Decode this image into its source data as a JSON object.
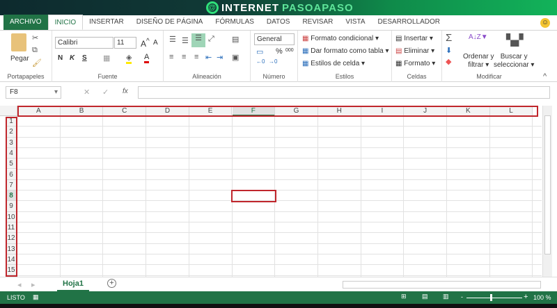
{
  "logo": {
    "text_a": "INTERNET",
    "text_b": "PASOAPASO"
  },
  "tabs": [
    "ARCHIVO",
    "INICIO",
    "INSERTAR",
    "DISEÑO DE PÁGINA",
    "FÓRMULAS",
    "DATOS",
    "REVISAR",
    "VISTA",
    "DESARROLLADOR"
  ],
  "active_tab": "INICIO",
  "ribbon": {
    "portapapeles": {
      "label": "Portapapeles",
      "paste": "Pegar"
    },
    "fuente": {
      "label": "Fuente",
      "font": "Calibri",
      "size": "11",
      "bold": "N",
      "italic": "K",
      "underline": "S"
    },
    "alineacion": {
      "label": "Alineación"
    },
    "numero": {
      "label": "Número",
      "format": "General",
      "percent": "%",
      "thousands": "000"
    },
    "estilos": {
      "label": "Estilos",
      "items": [
        "Formato condicional",
        "Dar formato como tabla",
        "Estilos de celda"
      ]
    },
    "celdas": {
      "label": "Celdas",
      "items": [
        "Insertar",
        "Eliminar",
        "Formato"
      ]
    },
    "modificar": {
      "label": "Modificar",
      "sort": [
        "Ordenar y",
        "filtrar"
      ],
      "find": [
        "Buscar y",
        "seleccionar"
      ]
    }
  },
  "formula_bar": {
    "name_box": "F8",
    "fx": "fx",
    "value": ""
  },
  "columns": [
    "A",
    "B",
    "C",
    "D",
    "E",
    "F",
    "G",
    "H",
    "I",
    "J",
    "K",
    "L"
  ],
  "rows": [
    "1",
    "2",
    "3",
    "4",
    "5",
    "6",
    "7",
    "8",
    "9",
    "10",
    "11",
    "12",
    "13",
    "14",
    "15"
  ],
  "selected_cell": {
    "column": "F",
    "row": "8"
  },
  "highlight_color": "#c0262c",
  "accent_color": "#217346",
  "sheets": [
    "Hoja1"
  ],
  "status": {
    "ready": "LISTO",
    "zoom": "100 %",
    "zoom_minus": "-",
    "zoom_plus": "+"
  }
}
